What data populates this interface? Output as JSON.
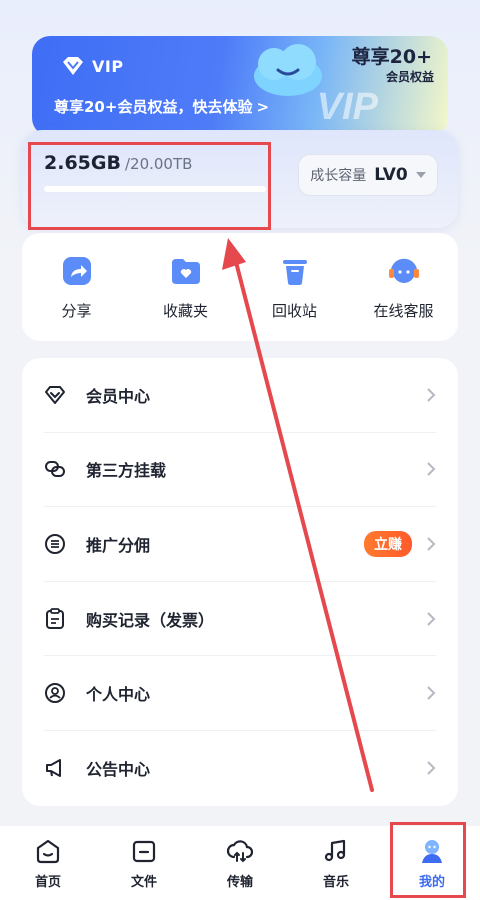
{
  "vip_banner": {
    "badge": "VIP",
    "promo_text": "尊享20+会员权益，快去体验",
    "promo_arrow": ">",
    "ghost_text": "VIP",
    "right_title": "尊享20+",
    "right_subtitle": "会员权益"
  },
  "storage": {
    "used": "2.65GB",
    "total": "/20.00TB",
    "used_fraction": 0.0001,
    "level_label": "成长容量",
    "level_value": "LV0"
  },
  "shortcuts": [
    {
      "label": "分享",
      "icon": "share-icon"
    },
    {
      "label": "收藏夹",
      "icon": "favorites-folder-icon"
    },
    {
      "label": "回收站",
      "icon": "trash-icon"
    },
    {
      "label": "在线客服",
      "icon": "headset-icon"
    }
  ],
  "menu": [
    {
      "label": "会员中心",
      "icon": "diamond-icon"
    },
    {
      "label": "第三方挂载",
      "icon": "link-icon"
    },
    {
      "label": "推广分佣",
      "icon": "commission-icon",
      "badge": "立赚"
    },
    {
      "label": "购买记录（发票）",
      "icon": "clipboard-icon"
    },
    {
      "label": "个人中心",
      "icon": "user-icon"
    },
    {
      "label": "公告中心",
      "icon": "megaphone-icon"
    }
  ],
  "bottom_nav": [
    {
      "label": "首页",
      "icon": "home-icon"
    },
    {
      "label": "文件",
      "icon": "folder-icon"
    },
    {
      "label": "传输",
      "icon": "cloud-transfer-icon"
    },
    {
      "label": "音乐",
      "icon": "music-icon"
    },
    {
      "label": "我的",
      "icon": "profile-icon",
      "active": true
    }
  ],
  "colors": {
    "accent": "#3d6cf0",
    "annotation": "#e5484d",
    "badge": "#ff6a2c"
  }
}
